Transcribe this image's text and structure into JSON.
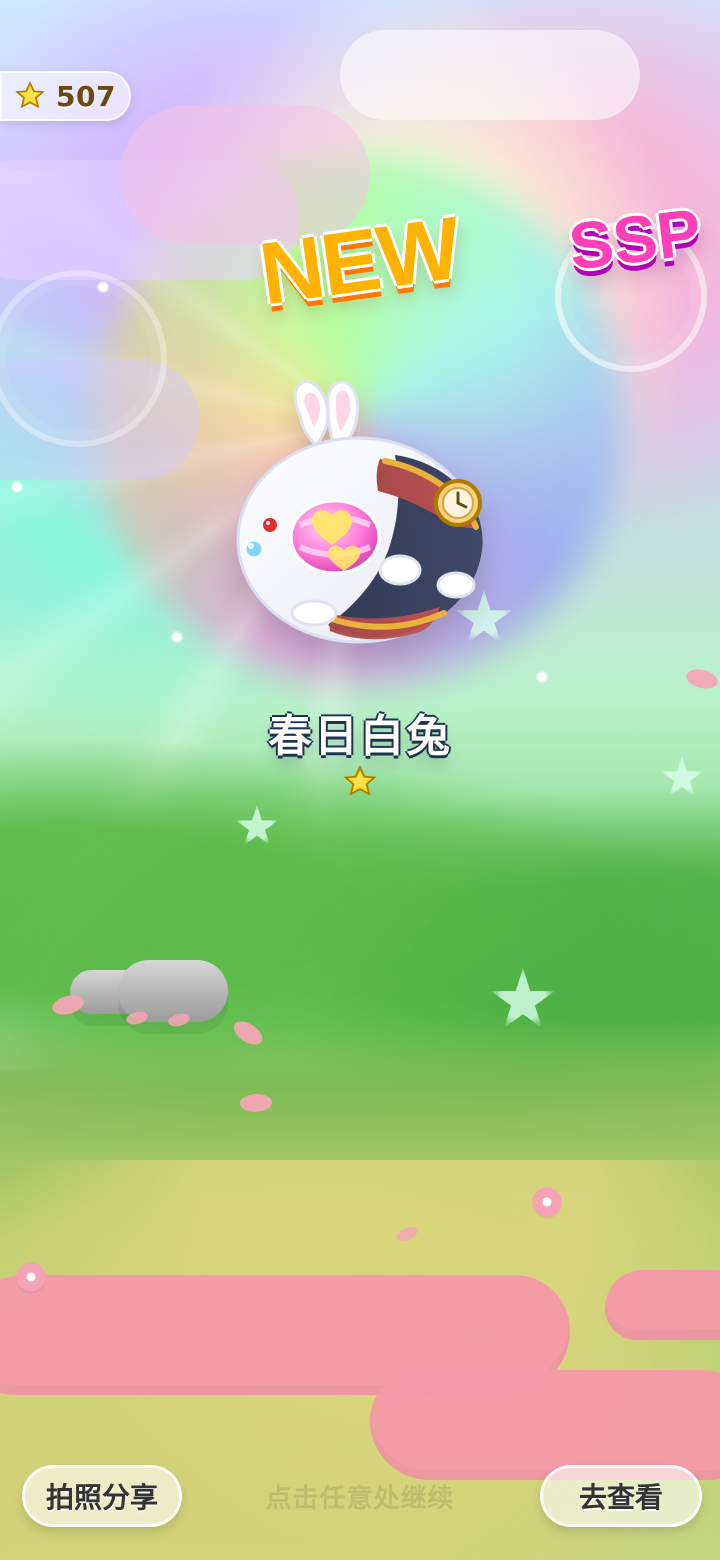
{
  "currency": {
    "amount": "507",
    "icon": "star-icon"
  },
  "badges": {
    "new": "NEW",
    "rarity": "SSP"
  },
  "reward": {
    "name": "春日白兔",
    "stars": 1,
    "star_icon": "star-icon"
  },
  "bottom": {
    "share_button": "拍照分享",
    "hint": "点击任意处继续",
    "view_button": "去查看"
  },
  "colors": {
    "coin_star": "#ffd400",
    "new_badge": "#ffb300",
    "ssp_badge": "#ff3fb8",
    "title_outline": "#1d3350",
    "pink_pool": "#f59aa9"
  }
}
